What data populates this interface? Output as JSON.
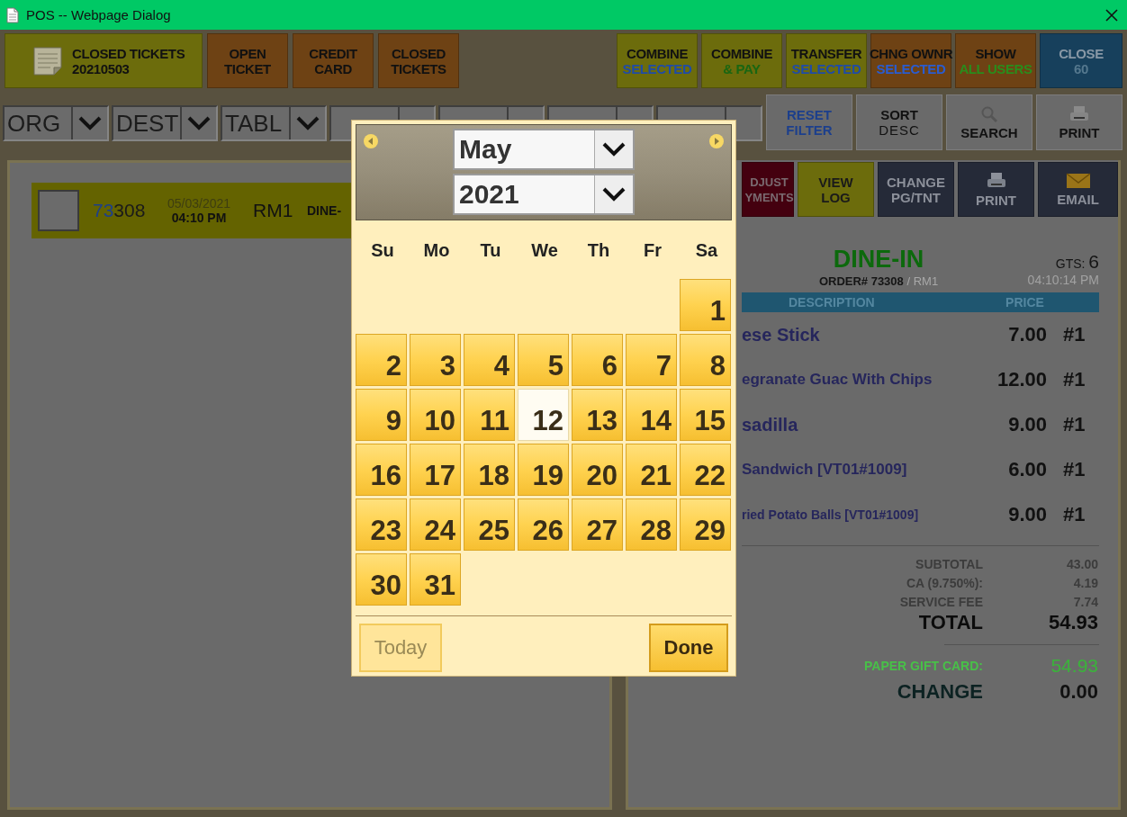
{
  "window": {
    "title": "POS -- Webpage Dialog"
  },
  "toolbar_left": [
    {
      "kind": "ticket",
      "label": "CLOSED TICKETS",
      "sublabel": "20210503",
      "color": "#6c6c0c"
    },
    {
      "kind": "text",
      "label": "OPEN",
      "sublabel": "TICKET",
      "color": "#6e4214"
    },
    {
      "kind": "text",
      "label": "CREDIT",
      "sublabel": "CARD",
      "color": "#6e4214"
    },
    {
      "kind": "text",
      "label": "CLOSED",
      "sublabel": "TICKETS",
      "color": "#6e4214"
    }
  ],
  "toolbar_right": [
    {
      "kind": "action",
      "label": "COMBINE",
      "sublabel": {
        "text": "SELECTED",
        "color": "#1f4ba8"
      },
      "color": "#6c6c0c"
    },
    {
      "kind": "action",
      "label": "COMBINE",
      "sublabel": {
        "text": "& PAY",
        "color": "#1a6612"
      },
      "color": "#6c6c0c"
    },
    {
      "kind": "action",
      "label": "TRANSFER",
      "sublabel": {
        "text": "SELECTED",
        "color": "#1f4ba8"
      },
      "color": "#6c6c0c"
    },
    {
      "kind": "action",
      "label": "CHNG OWNR",
      "sublabel": {
        "text": "SELECTED",
        "color": "#2a5cd0"
      },
      "color": "#6e4214"
    },
    {
      "kind": "action",
      "label": "SHOW",
      "sublabel": {
        "text": "ALL USERS",
        "color": "#2a8c1c"
      },
      "color": "#6e4214"
    },
    {
      "kind": "close",
      "label": "CLOSE",
      "sublabel": {
        "text": "60",
        "color": "#55788e"
      },
      "color": "#17405c"
    }
  ],
  "filters": [
    {
      "label": "ORG"
    },
    {
      "label": "DEST"
    },
    {
      "label": "TABL"
    },
    {
      "kind": "covered"
    },
    {
      "kind": "covered"
    },
    {
      "kind": "covered"
    },
    {
      "kind": "covered"
    }
  ],
  "filter_buttons": [
    {
      "kind": "text",
      "label": "RESET",
      "sublabel": "FILTER"
    },
    {
      "kind": "text",
      "label": "SORT",
      "sublabel": "DESC"
    },
    {
      "kind": "search",
      "label": "SEARCH"
    },
    {
      "kind": "print",
      "label": "PRINT"
    }
  ],
  "tickets": [
    {
      "checked": false,
      "number_highlight": "73",
      "number": "308",
      "date": "05/03/2021",
      "time": "04:10 PM",
      "room": "RM1",
      "type": "DINE-"
    }
  ],
  "receipt_buttons": [
    {
      "kind": "text",
      "label": "DJUST",
      "sublabel": "YMENTS",
      "color": "#44000f"
    },
    {
      "kind": "text",
      "label": "VIEW",
      "sublabel": "LOG",
      "color": "#6c6c0c"
    },
    {
      "kind": "text",
      "label": "CHANGE",
      "sublabel": "PG/TNT",
      "color": "#252a38"
    },
    {
      "kind": "print",
      "label": "PRINT",
      "color": "#252a38"
    },
    {
      "kind": "email",
      "label": "EMAIL",
      "color": "#252a38"
    }
  ],
  "receipt": {
    "order_type": "DINE-IN",
    "order": "ORDER# 73308",
    "order_suffix": "/ RM1",
    "guests_label": "GTS:",
    "guests": "6",
    "time": "04:10:14 PM",
    "columns": [
      "DESCRIPTION",
      "PRICE"
    ],
    "items": [
      {
        "description": "ese Stick",
        "price": "7.00",
        "seat": "#1",
        "kind": "large"
      },
      {
        "description": "egranate Guac With Chips",
        "price": "12.00",
        "seat": "#1",
        "kind": "medium"
      },
      {
        "description": "sadilla",
        "price": "9.00",
        "seat": "#1",
        "kind": "large"
      },
      {
        "description": "Sandwich [VT01#1009]",
        "price": "6.00",
        "seat": "#1",
        "kind": "medium"
      },
      {
        "description": "ried Potato Balls [VT01#1009]",
        "price": "9.00",
        "seat": "#1",
        "kind": "small"
      }
    ],
    "totals": [
      {
        "kind": "minor",
        "label": "SUBTOTAL",
        "value": "43.00"
      },
      {
        "kind": "minor",
        "label": "CA (9.750%):",
        "value": "4.19"
      },
      {
        "kind": "minor",
        "label": "SERVICE FEE",
        "value": "7.74"
      },
      {
        "kind": "total",
        "label": "TOTAL",
        "value": "54.93"
      },
      {
        "kind": "payment",
        "label": "PAPER GIFT CARD:",
        "value": "54.93"
      },
      {
        "kind": "change",
        "label": "CHANGE",
        "value": "0.00"
      }
    ]
  },
  "calendar": {
    "month": "May",
    "year": "2021",
    "weekdays": [
      "Su",
      "Mo",
      "Tu",
      "We",
      "Th",
      "Fr",
      "Sa"
    ],
    "cells": [
      {
        "kind": "blank"
      },
      {
        "kind": "blank"
      },
      {
        "kind": "blank"
      },
      {
        "kind": "blank"
      },
      {
        "kind": "blank"
      },
      {
        "kind": "blank"
      },
      {
        "kind": "day",
        "label": "1",
        "selected": false
      },
      {
        "kind": "day",
        "label": "2",
        "selected": false
      },
      {
        "kind": "day",
        "label": "3",
        "selected": false
      },
      {
        "kind": "day",
        "label": "4",
        "selected": false
      },
      {
        "kind": "day",
        "label": "5",
        "selected": false
      },
      {
        "kind": "day",
        "label": "6",
        "selected": false
      },
      {
        "kind": "day",
        "label": "7",
        "selected": false
      },
      {
        "kind": "day",
        "label": "8",
        "selected": false
      },
      {
        "kind": "day",
        "label": "9",
        "selected": false
      },
      {
        "kind": "day",
        "label": "10",
        "selected": false
      },
      {
        "kind": "day",
        "label": "11",
        "selected": false
      },
      {
        "kind": "day",
        "label": "12",
        "selected": true
      },
      {
        "kind": "day",
        "label": "13",
        "selected": false
      },
      {
        "kind": "day",
        "label": "14",
        "selected": false
      },
      {
        "kind": "day",
        "label": "15",
        "selected": false
      },
      {
        "kind": "day",
        "label": "16",
        "selected": false
      },
      {
        "kind": "day",
        "label": "17",
        "selected": false
      },
      {
        "kind": "day",
        "label": "18",
        "selected": false
      },
      {
        "kind": "day",
        "label": "19",
        "selected": false
      },
      {
        "kind": "day",
        "label": "20",
        "selected": false
      },
      {
        "kind": "day",
        "label": "21",
        "selected": false
      },
      {
        "kind": "day",
        "label": "22",
        "selected": false
      },
      {
        "kind": "day",
        "label": "23",
        "selected": false
      },
      {
        "kind": "day",
        "label": "24",
        "selected": false
      },
      {
        "kind": "day",
        "label": "25",
        "selected": false
      },
      {
        "kind": "day",
        "label": "26",
        "selected": false
      },
      {
        "kind": "day",
        "label": "27",
        "selected": false
      },
      {
        "kind": "day",
        "label": "28",
        "selected": false
      },
      {
        "kind": "day",
        "label": "29",
        "selected": false
      },
      {
        "kind": "day",
        "label": "30",
        "selected": false
      },
      {
        "kind": "day",
        "label": "31",
        "selected": false
      }
    ],
    "buttons": [
      {
        "kind": "today",
        "label": "Today",
        "disabled": true
      },
      {
        "kind": "done",
        "label": "Done",
        "disabled": false
      }
    ]
  }
}
